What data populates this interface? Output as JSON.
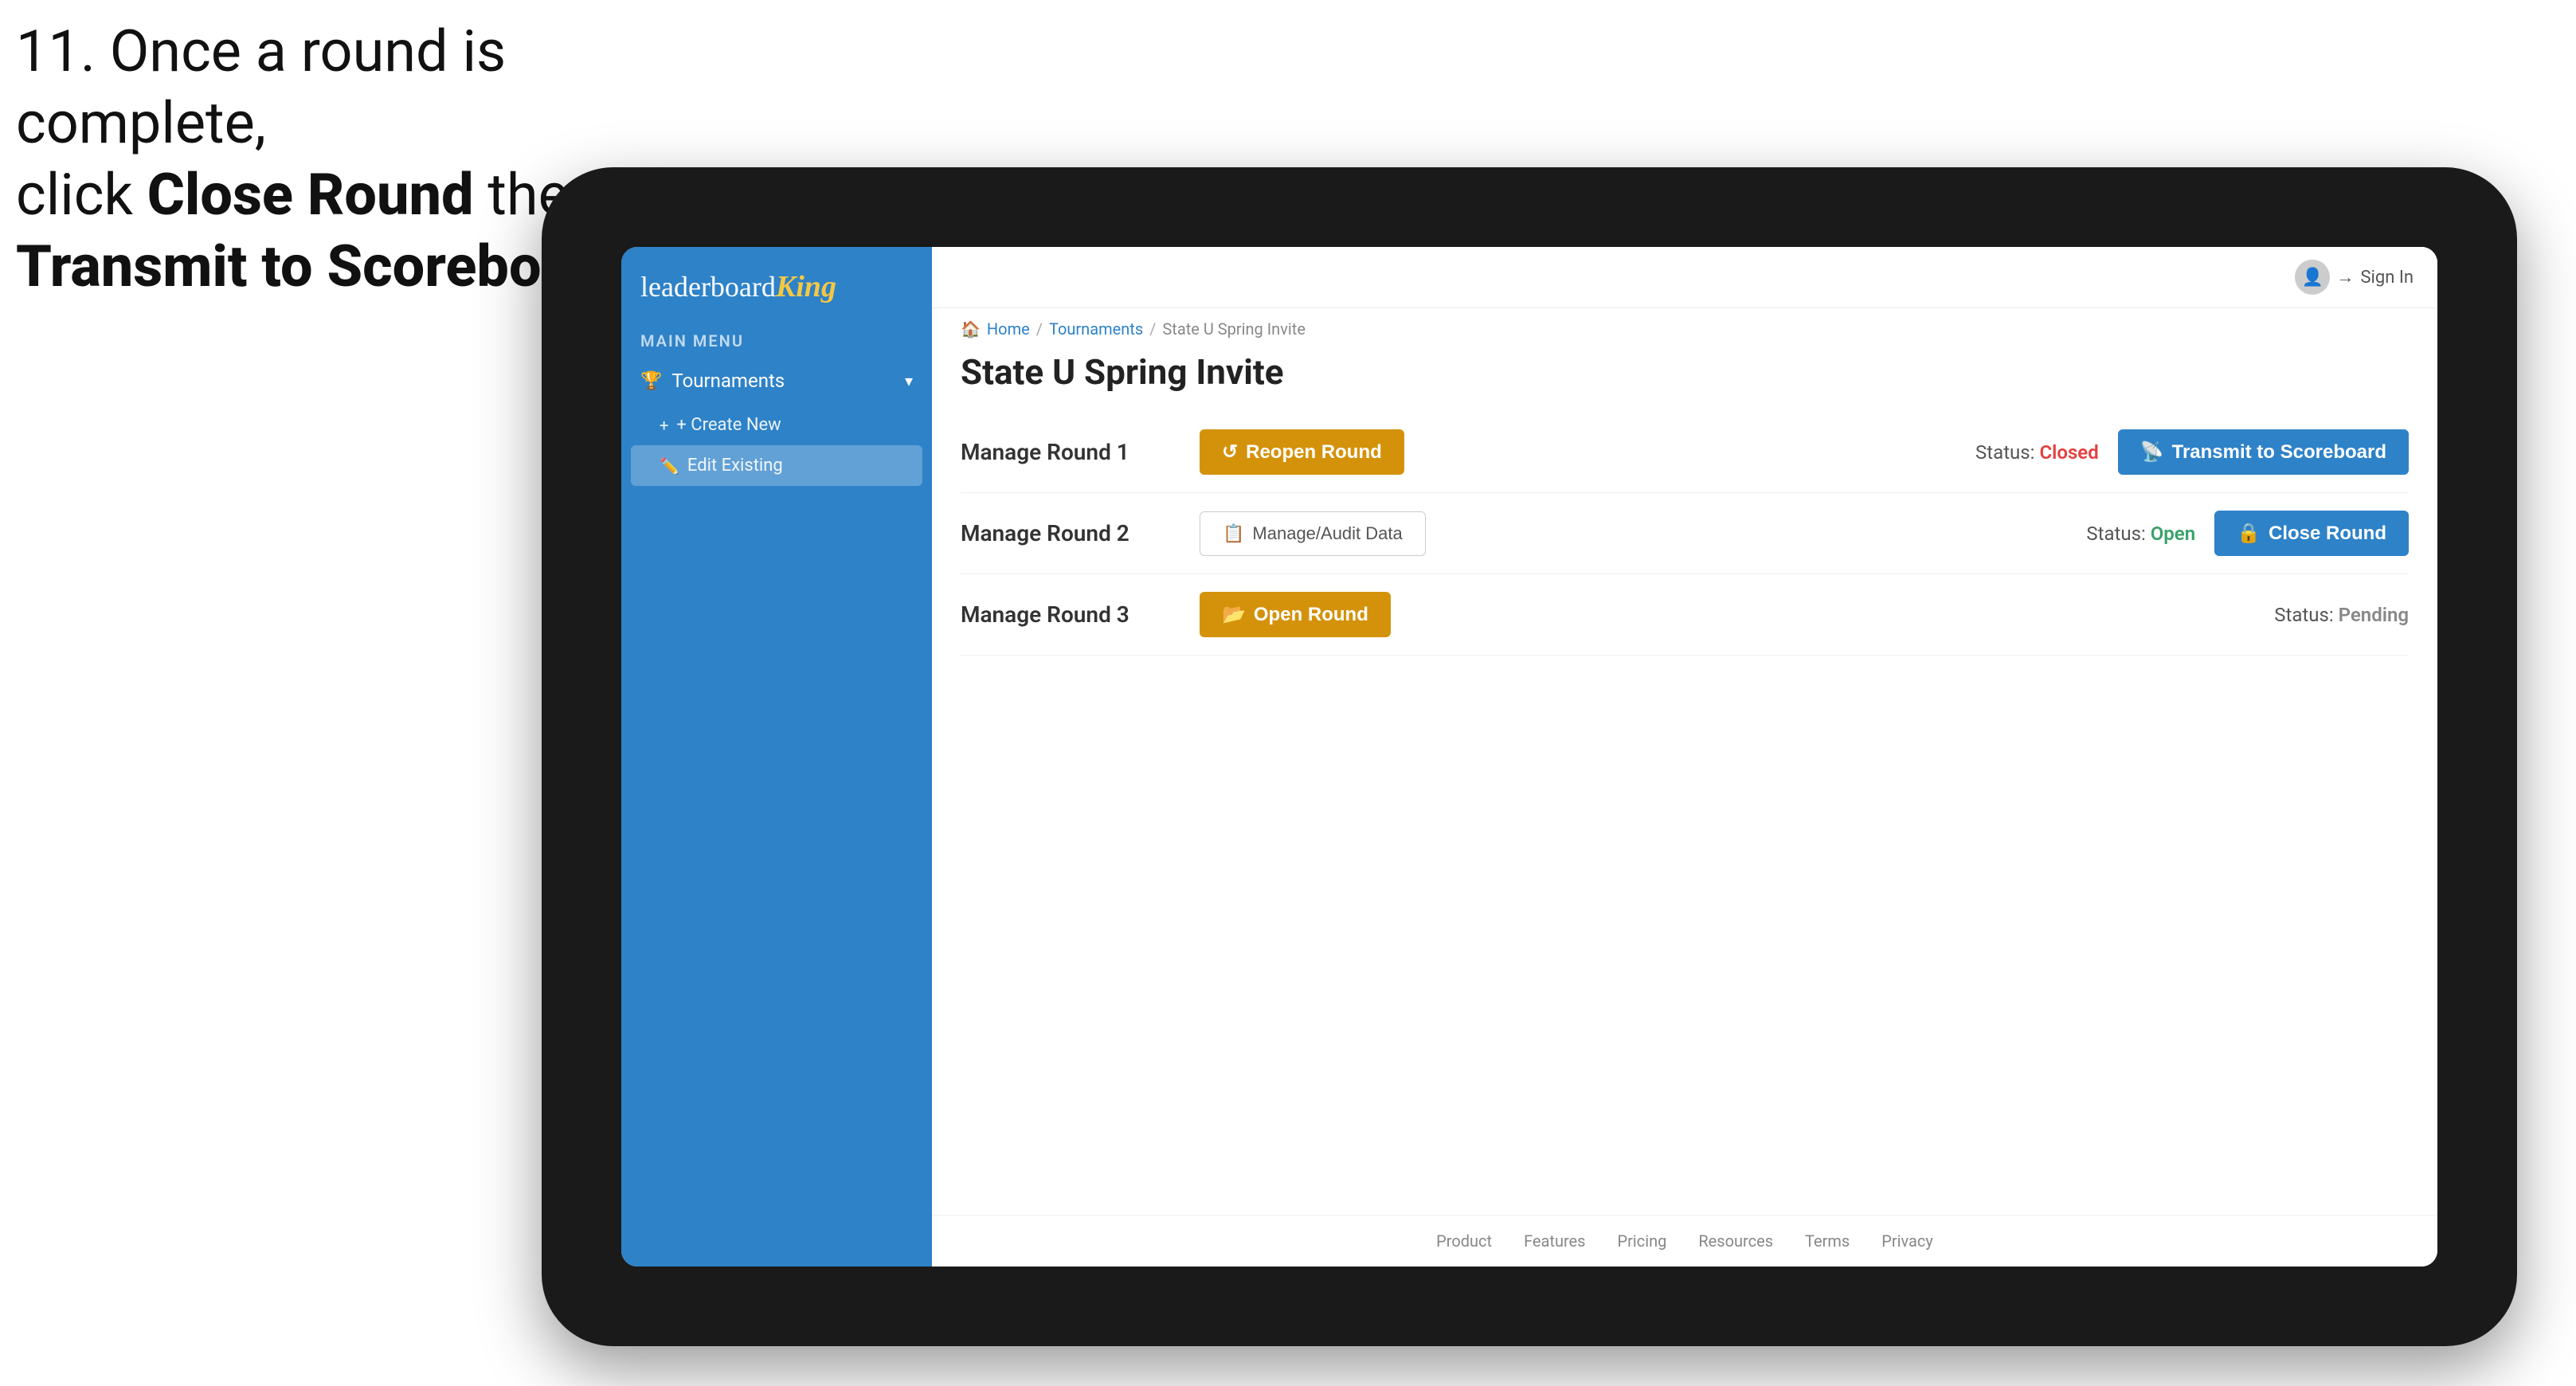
{
  "instruction": {
    "line1": "11. Once a round is complete,",
    "line2_plain": "click ",
    "line2_bold": "Close Round",
    "line2_end": " then click",
    "line3_bold": "Transmit to Scoreboard."
  },
  "app": {
    "logo": {
      "leaderboard": "leaderboard",
      "king": "King"
    },
    "sidebar": {
      "menu_label": "MAIN MENU",
      "tournaments_label": "Tournaments",
      "create_new_label": "+ Create New",
      "edit_existing_label": "Edit Existing"
    },
    "topbar": {
      "sign_in_label": "Sign In"
    },
    "breadcrumb": {
      "home": "Home",
      "tournaments": "Tournaments",
      "current": "State U Spring Invite"
    },
    "page_title": "State U Spring Invite",
    "rounds": [
      {
        "title": "Manage Round 1",
        "status_label": "Status:",
        "status_value": "Closed",
        "status_class": "status-closed",
        "primary_btn_label": "Reopen Round",
        "primary_btn_class": "btn-amber",
        "secondary_btn_label": "Transmit to Scoreboard",
        "secondary_btn_class": "btn-blue"
      },
      {
        "title": "Manage Round 2",
        "status_label": "Status:",
        "status_value": "Open",
        "status_class": "status-open",
        "audit_btn_label": "Manage/Audit Data",
        "primary_btn_label": "Close Round",
        "primary_btn_class": "btn-blue"
      },
      {
        "title": "Manage Round 3",
        "status_label": "Status:",
        "status_value": "Pending",
        "status_class": "status-pending",
        "primary_btn_label": "Open Round",
        "primary_btn_class": "btn-amber"
      }
    ],
    "footer": {
      "links": [
        "Product",
        "Features",
        "Pricing",
        "Resources",
        "Terms",
        "Privacy"
      ]
    }
  }
}
